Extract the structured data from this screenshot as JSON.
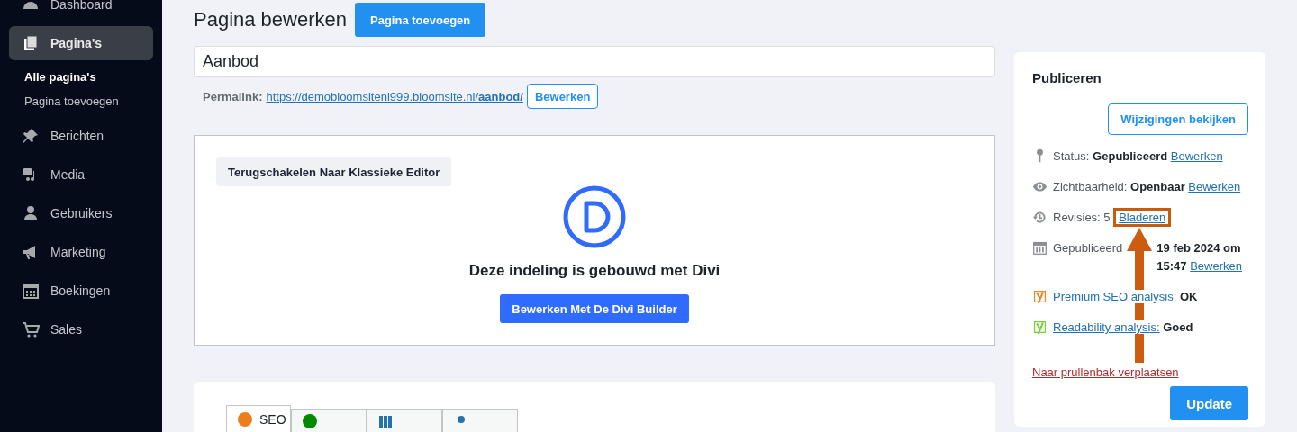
{
  "sidebar": {
    "items": [
      {
        "label": "Dashboard",
        "kind": "dashboard",
        "selected": false
      },
      {
        "label": "Pagina's",
        "kind": "pages",
        "selected": true,
        "children": [
          {
            "label": "Alle pagina's",
            "selected": true
          },
          {
            "label": "Pagina toevoegen",
            "selected": false
          }
        ]
      },
      {
        "label": "Berichten",
        "kind": "pin",
        "selected": false
      },
      {
        "label": "Media",
        "kind": "media",
        "selected": false
      },
      {
        "label": "Gebruikers",
        "kind": "user",
        "selected": false
      },
      {
        "label": "Marketing",
        "kind": "megaphone",
        "selected": false
      },
      {
        "label": "Boekingen",
        "kind": "calendar",
        "selected": false
      },
      {
        "label": "Sales",
        "kind": "cart",
        "selected": false
      }
    ]
  },
  "header": {
    "title": "Pagina bewerken",
    "add_button": "Pagina toevoegen"
  },
  "title_field": {
    "value": "Aanbod"
  },
  "permalink": {
    "label": "Permalink:",
    "url_prefix": "https://demobloomsitenl999.bloomsite.nl/",
    "url_slug": "aanbod/",
    "edit_button": "Bewerken"
  },
  "divi": {
    "classic_button": "Terugschakelen Naar Klassieke Editor",
    "message": "Deze indeling is gebouwd met Divi",
    "builder_button": "Bewerken Met De Divi Builder"
  },
  "seo_tabs": [
    {
      "label": "SEO",
      "kind": "seo",
      "selected": true
    },
    {
      "kind": "readability",
      "selected": false
    },
    {
      "kind": "schema",
      "selected": false
    },
    {
      "kind": "social",
      "selected": false
    }
  ],
  "publish": {
    "title": "Publiceren",
    "preview_button": "Wijzigingen bekijken",
    "rows": [
      {
        "kind": "status",
        "label": "Status:",
        "value": "Gepubliceerd",
        "link": "Bewerken",
        "highlighted": false
      },
      {
        "kind": "visibility",
        "label": "Zichtbaarheid:",
        "value": "Openbaar",
        "link": "Bewerken",
        "highlighted": false
      },
      {
        "kind": "revisions",
        "label": "Revisies: 5",
        "link": "Bladeren",
        "highlighted": true
      },
      {
        "kind": "date",
        "label": "Gepubliceerd",
        "value": "19 feb 2024 om 15:47",
        "link": "Bewerken",
        "highlighted": false
      },
      {
        "kind": "yoast",
        "color": "#f0862a",
        "link": "Premium SEO analysis:",
        "value": "OK",
        "highlighted": false
      },
      {
        "kind": "yoast",
        "color": "#7ad03a",
        "link": "Readability analysis:",
        "value": "Goed",
        "highlighted": false
      }
    ],
    "trash_link": "Naar prullenbak verplaatsen",
    "update_button": "Update"
  }
}
